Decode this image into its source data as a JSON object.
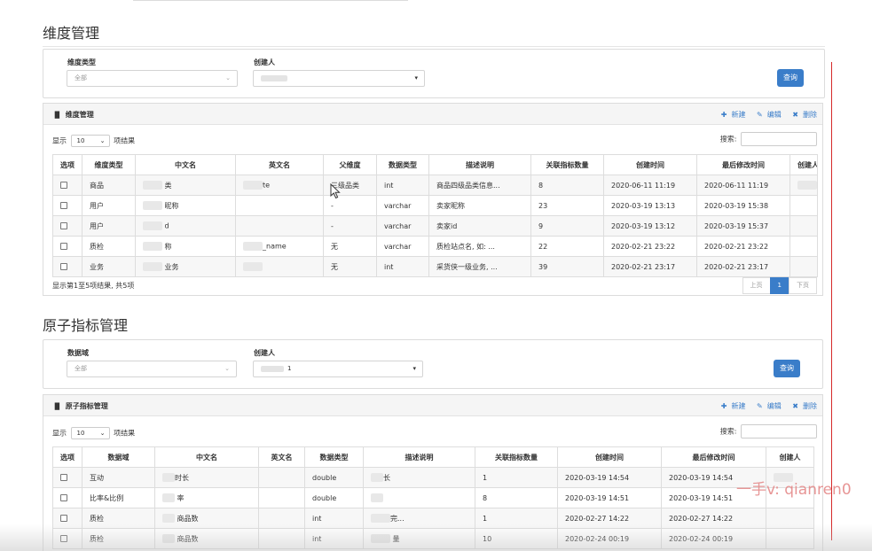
{
  "section1": {
    "title": "维度管理",
    "filters": {
      "type_label": "维度类型",
      "type_value": "全部",
      "creator_label": "创建人",
      "query_button": "查询"
    },
    "panel": {
      "title": "维度管理",
      "new": "新建",
      "edit": "编辑",
      "delete": "删除",
      "show_prefix": "显示",
      "page_len": "10",
      "show_suffix": "项结果",
      "search_label": "搜索:",
      "columns": [
        "选项",
        "维度类型",
        "中文名",
        "英文名",
        "父维度",
        "数据类型",
        "描述说明",
        "关联指标数量",
        "创建时间",
        "最后修改时间",
        "创建人"
      ],
      "rows": [
        {
          "type": "商品",
          "cn": "类",
          "en": "te",
          "parent": "三级品类",
          "dtype": "int",
          "desc": "商品四级品类信息...",
          "count": "8",
          "created": "2020-06-11 11:19",
          "modified": "2020-06-11 11:19"
        },
        {
          "type": "用户",
          "cn": "昵称",
          "en": "",
          "parent": "-",
          "dtype": "varchar",
          "desc": "卖家昵称",
          "count": "23",
          "created": "2020-03-19 13:13",
          "modified": "2020-03-19 15:38"
        },
        {
          "type": "用户",
          "cn": "d",
          "en": "",
          "parent": "-",
          "dtype": "varchar",
          "desc": "卖家id",
          "count": "9",
          "created": "2020-03-19 13:12",
          "modified": "2020-03-19 15:37"
        },
        {
          "type": "质检",
          "cn": "称",
          "en": "_name",
          "parent": "无",
          "dtype": "varchar",
          "desc": "质检站点名, 如: ...",
          "count": "22",
          "created": "2020-02-21 23:22",
          "modified": "2020-02-21 23:22"
        },
        {
          "type": "业务",
          "cn": "业务",
          "en": "",
          "parent": "无",
          "dtype": "int",
          "desc": "采货侠一级业务, ...",
          "count": "39",
          "created": "2020-02-21 23:17",
          "modified": "2020-02-21 23:17"
        }
      ],
      "info": "显示第1至5项结果, 共5项",
      "prev": "上页",
      "page": "1",
      "next": "下页"
    }
  },
  "section2": {
    "title": "原子指标管理",
    "filters": {
      "domain_label": "数据域",
      "domain_value": "全部",
      "creator_label": "创建人",
      "creator_value": "1",
      "query_button": "查询"
    },
    "panel": {
      "title": "原子指标管理",
      "new": "新建",
      "edit": "编辑",
      "delete": "删除",
      "show_prefix": "显示",
      "page_len": "10",
      "show_suffix": "项结果",
      "search_label": "搜索:",
      "columns": [
        "选项",
        "数据域",
        "中文名",
        "英文名",
        "数据类型",
        "描述说明",
        "关联指标数量",
        "创建时间",
        "最后修改时间",
        "创建人"
      ],
      "rows": [
        {
          "domain": "互动",
          "cn": "时长",
          "en": "",
          "dtype": "double",
          "desc": "长",
          "count": "1",
          "created": "2020-03-19 14:54",
          "modified": "2020-03-19 14:54"
        },
        {
          "domain": "比率&比例",
          "cn": "率",
          "en": "",
          "dtype": "double",
          "desc": "",
          "count": "8",
          "created": "2020-03-19 14:51",
          "modified": "2020-03-19 14:51"
        },
        {
          "domain": "质检",
          "cn": "商品数",
          "en": "",
          "dtype": "int",
          "desc": "完...",
          "count": "1",
          "created": "2020-02-27 14:22",
          "modified": "2020-02-27 14:22"
        },
        {
          "domain": "质检",
          "cn": "商品数",
          "en": "",
          "dtype": "int",
          "desc": "量",
          "count": "10",
          "created": "2020-02-24 00:19",
          "modified": "2020-02-24 00:19"
        }
      ]
    }
  },
  "watermark": "一手v: qianren0",
  "colors": {
    "accent": "#3a7dc9",
    "red_line": "#d62a2a"
  },
  "icons": {
    "chart": "bar-chart-icon",
    "plus": "plus-icon",
    "pencil": "pencil-icon",
    "times": "times-icon",
    "cursor": "mouse-pointer-icon"
  }
}
